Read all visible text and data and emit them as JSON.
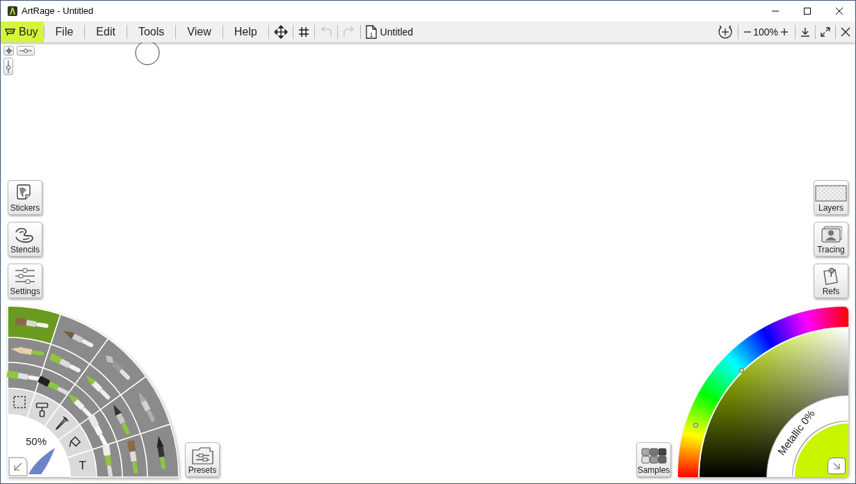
{
  "window": {
    "title": "ArtRage - Untitled"
  },
  "menu": [
    {
      "label": "Buy",
      "highlighted": true
    },
    {
      "label": "File",
      "highlighted": false
    },
    {
      "label": "Edit",
      "highlighted": false
    },
    {
      "label": "Tools",
      "highlighted": false
    },
    {
      "label": "View",
      "highlighted": false
    },
    {
      "label": "Help",
      "highlighted": false
    }
  ],
  "toolbar": {
    "undo": {
      "disabled": true
    },
    "redo": {
      "disabled": true
    },
    "document": {
      "page": "1",
      "name": "Untitled"
    },
    "zoom": "100%"
  },
  "left_buttons": [
    {
      "label": "Stickers",
      "kind": "stickers"
    },
    {
      "label": "Stencils",
      "kind": "stencils"
    },
    {
      "label": "Settings",
      "kind": "settings"
    }
  ],
  "right_buttons": [
    {
      "label": "Layers",
      "kind": "layers"
    },
    {
      "label": "Tracing",
      "kind": "tracing"
    },
    {
      "label": "Refs",
      "kind": "refs"
    }
  ],
  "presets_button": {
    "label": "Presets"
  },
  "samples_button": {
    "label": "Samples"
  },
  "tool_wheel": {
    "brush_size": "50%",
    "rings": [
      {
        "tools": [
          {
            "kind": "selection",
            "selected": false
          },
          {
            "kind": "stencil-roller",
            "selected": false
          },
          {
            "kind": "dropper",
            "selected": false
          },
          {
            "kind": "fill",
            "selected": false
          },
          {
            "kind": "text",
            "label": "T",
            "selected": false
          }
        ]
      },
      {
        "tools": [
          {
            "kind": "eraser",
            "selected": false
          },
          {
            "kind": "sticker-spray",
            "selected": false
          },
          {
            "kind": "crayon",
            "selected": false
          },
          {
            "kind": "paint-tube",
            "selected": false
          },
          {
            "kind": "glitter",
            "selected": false
          }
        ]
      },
      {
        "tools": [
          {
            "kind": "pencil",
            "selected": false
          },
          {
            "kind": "paint-roller",
            "selected": false
          },
          {
            "kind": "marker",
            "selected": false
          },
          {
            "kind": "ink-pen",
            "selected": false
          },
          {
            "kind": "custom-brush",
            "selected": false
          }
        ]
      },
      {
        "tools": [
          {
            "kind": "flat-brush",
            "selected": true
          },
          {
            "kind": "round-brush",
            "selected": false
          },
          {
            "kind": "palette-knife",
            "selected": false
          },
          {
            "kind": "airbrush",
            "selected": false
          },
          {
            "kind": "technical-pen",
            "selected": false
          }
        ]
      }
    ]
  },
  "color_picker": {
    "color": "#c8f500",
    "metallic": "Metallic 0%"
  }
}
